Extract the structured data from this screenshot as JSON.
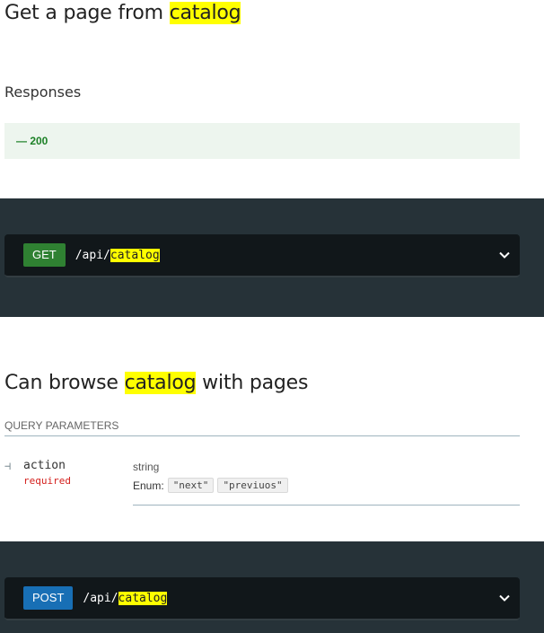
{
  "section1": {
    "title_prefix": "Get a page from ",
    "title_highlight": "catalog",
    "responses_label": "Responses",
    "response_code": "— 200"
  },
  "endpoint_get": {
    "method": "GET",
    "path_prefix": "/api/",
    "path_highlight": "catalog"
  },
  "section2": {
    "title_prefix": "Can browse ",
    "title_highlight": "catalog",
    "title_suffix": " with pages",
    "query_params_label": "QUERY PARAMETERS",
    "param": {
      "name": "action",
      "required": "required",
      "type": "string",
      "enum_label": "Enum:",
      "enum_values": [
        "\"next\"",
        "\"previuos\""
      ]
    }
  },
  "endpoint_post": {
    "method": "POST",
    "path_prefix": "/api/",
    "path_highlight": "catalog"
  },
  "colors": {
    "dark_band": "#263238",
    "get_method": "#2f8132",
    "post_method": "#186fb5",
    "highlight": "#ffff00",
    "response_success": "#1d8127"
  },
  "icons": {
    "expand": "chevron-down-icon",
    "tree": "tree-branch-icon"
  }
}
